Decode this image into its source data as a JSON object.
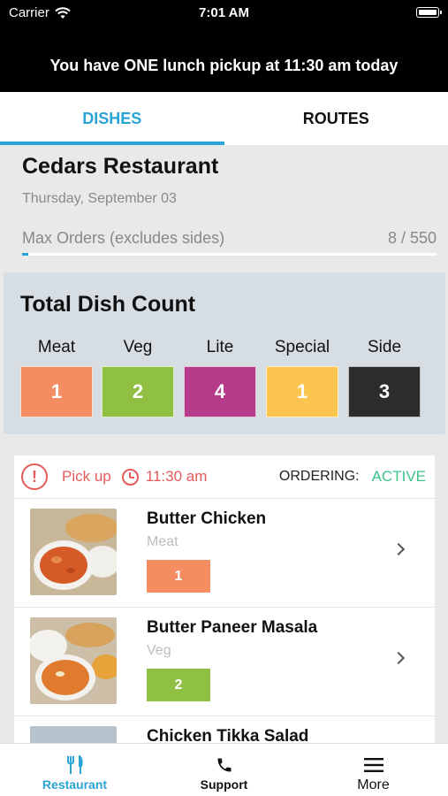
{
  "status_bar": {
    "carrier": "Carrier",
    "time": "7:01 AM"
  },
  "banner": {
    "text": "You have ONE lunch pickup at 11:30 am today"
  },
  "tabs": [
    {
      "label": "DISHES",
      "active": true
    },
    {
      "label": "ROUTES",
      "active": false
    }
  ],
  "restaurant": {
    "name": "Cedars Restaurant",
    "date": "Thursday, September 03",
    "max_orders_label": "Max Orders (excludes sides)",
    "max_orders_value": "8 / 550",
    "max_orders_progress": 0.015
  },
  "total_count": {
    "title": "Total Dish Count",
    "items": [
      {
        "label": "Meat",
        "value": "1",
        "color": "#f58d63"
      },
      {
        "label": "Veg",
        "value": "2",
        "color": "#8fc043"
      },
      {
        "label": "Lite",
        "value": "4",
        "color": "#b63c8a"
      },
      {
        "label": "Special",
        "value": "1",
        "color": "#fbc54f"
      },
      {
        "label": "Side",
        "value": "3",
        "color": "#2c2c2c"
      }
    ]
  },
  "pickup": {
    "alert_icon": "!",
    "label": "Pick up",
    "time": "11:30 am",
    "ordering_label": "ORDERING:",
    "ordering_status": "ACTIVE"
  },
  "dishes": [
    {
      "name": "Butter Chicken",
      "category": "Meat",
      "count": "1",
      "color": "#f58d63"
    },
    {
      "name": "Butter Paneer Masala",
      "category": "Veg",
      "count": "2",
      "color": "#8fc043"
    },
    {
      "name": "Chicken Tikka Salad",
      "category": "",
      "count": "",
      "color": "#8fc043"
    }
  ],
  "bottom_nav": [
    {
      "label": "Restaurant",
      "icon": "fork-knife-icon",
      "active": true
    },
    {
      "label": "Support",
      "icon": "phone-icon",
      "active": false
    },
    {
      "label": "More",
      "icon": "hamburger-menu-icon",
      "active": false
    }
  ]
}
